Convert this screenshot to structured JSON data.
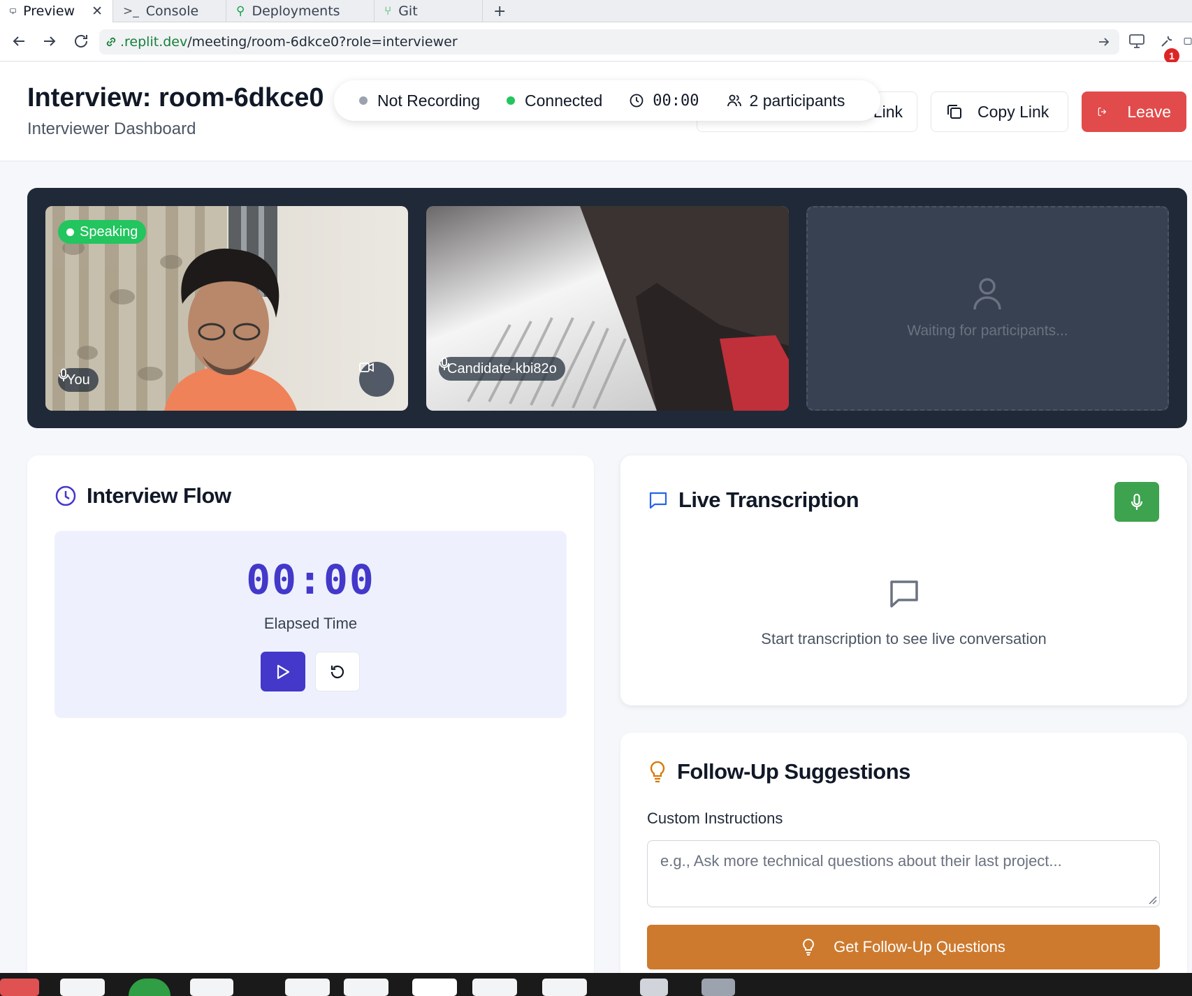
{
  "browser": {
    "tabs": [
      {
        "label": "Preview",
        "icon": "monitor-icon",
        "active": true
      },
      {
        "label": "Console",
        "icon": "terminal-icon",
        "active": false
      },
      {
        "label": "Deployments",
        "icon": "deploy-icon",
        "active": false
      },
      {
        "label": "Git",
        "icon": "git-icon",
        "active": false
      }
    ],
    "new_tab": "+",
    "url_domain": ".replit.dev",
    "url_path": "/meeting/room-6dkce0?role=interviewer",
    "notification_count": "1"
  },
  "header": {
    "title": "Interview: room-6dkce0",
    "subtitle": "Interviewer Dashboard",
    "hidden_button_label": "Link",
    "copy_link_label": "Copy Link",
    "leave_label": "Leave"
  },
  "status": {
    "recording": "Not Recording",
    "connection": "Connected",
    "timer": "00:00",
    "participants": "2 participants",
    "colors": {
      "recording_dot": "#9ca3af",
      "connected_dot": "#22c55e"
    }
  },
  "videos": {
    "self": {
      "label": "You",
      "speaking_badge": "Speaking"
    },
    "candidate": {
      "label": "Candidate-kbi82o"
    },
    "empty": {
      "label": "Waiting for participants..."
    }
  },
  "interview_flow": {
    "title": "Interview Flow",
    "elapsed": "00:00",
    "elapsed_label": "Elapsed Time"
  },
  "transcription": {
    "title": "Live Transcription",
    "empty_text": "Start transcription to see live conversation"
  },
  "followup": {
    "title": "Follow-Up Suggestions",
    "instructions_label": "Custom Instructions",
    "instructions_placeholder": "e.g., Ask more technical questions about their last project...",
    "submit_label": "Get Follow-Up Questions"
  },
  "colors": {
    "accent": "#4338ca",
    "danger": "#e24b4b",
    "success": "#3da34f",
    "warning": "#cd7a2f",
    "video_panel": "#1f2937"
  }
}
